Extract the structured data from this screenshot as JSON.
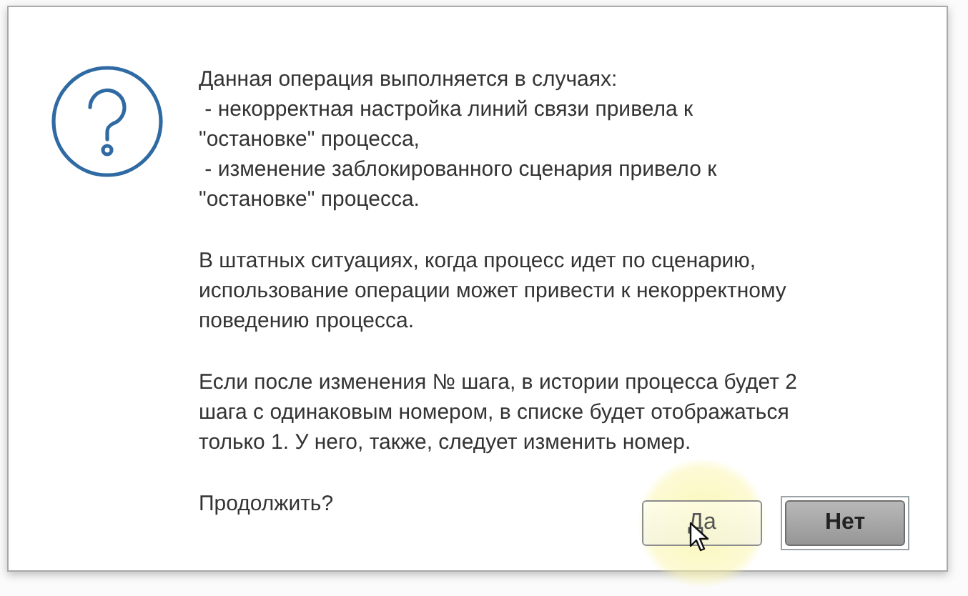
{
  "dialog": {
    "message": [
      [
        "Данная операция выполняется в случаях:",
        " - некорректная настройка линий связи привела к",
        "\"остановке\" процесса,",
        " - изменение заблокированного сценария привело к",
        "\"остановке\" процесса."
      ],
      [
        "В штатных ситуациях, когда процесс идет по сценарию,",
        "использование операции может привести к некорректному",
        "поведению процесса."
      ],
      [
        "Если после изменения № шага, в истории процесса будет 2",
        "шага с одинаковым номером, в списке будет отображаться",
        "только 1. У него, также, следует изменить номер."
      ],
      [
        "Продолжить?"
      ]
    ],
    "buttons": [
      {
        "label": "Да",
        "default": false,
        "hovered": true
      },
      {
        "label": "Нет",
        "default": true,
        "hovered": false
      }
    ]
  }
}
